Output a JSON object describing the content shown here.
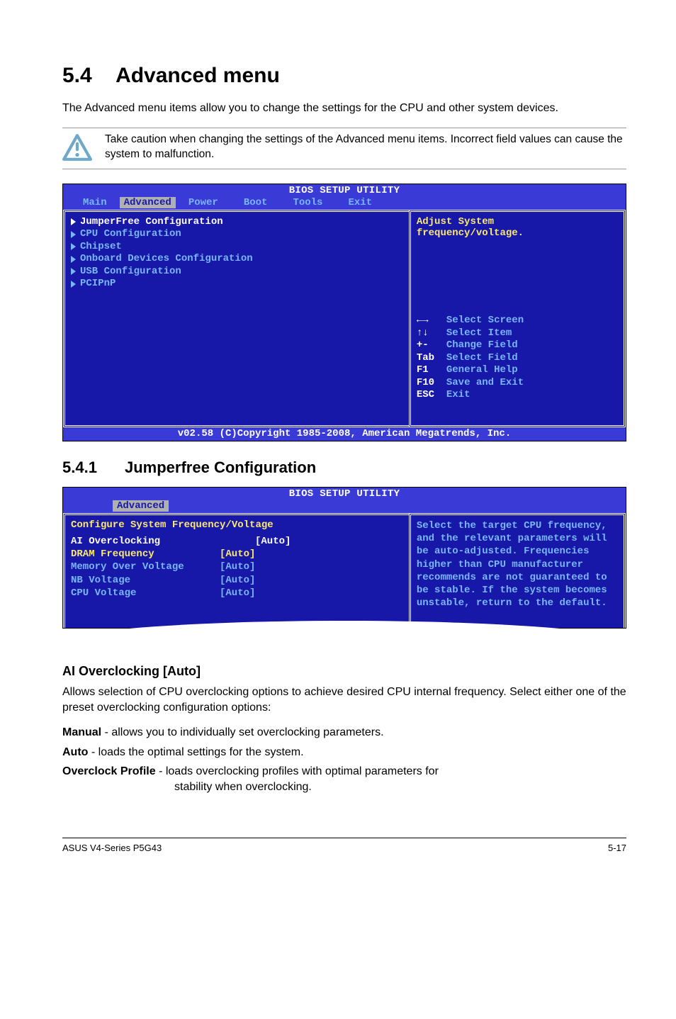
{
  "section": {
    "number": "5.4",
    "title": "Advanced menu",
    "intro": "The Advanced menu items allow you to change the settings for the CPU and other system devices.",
    "note": "Take caution when changing the settings of the Advanced menu items. Incorrect field values can cause the system to malfunction."
  },
  "bios1": {
    "title": "BIOS SETUP UTILITY",
    "tabs": [
      "Main",
      "Advanced",
      "Power",
      "Boot",
      "Tools",
      "Exit"
    ],
    "active_tab": "Advanced",
    "left_items": [
      "JumperFree Configuration",
      "CPU Configuration",
      "Chipset",
      "Onboard Devices Configuration",
      "USB Configuration",
      "PCIPnP"
    ],
    "highlight_index": 0,
    "right_help": "Adjust System\nfrequency/voltage.",
    "nav": [
      {
        "key": "←→",
        "label": "Select Screen"
      },
      {
        "key": "↑↓",
        "label": "Select Item"
      },
      {
        "key": "+-",
        "label": "Change Field"
      },
      {
        "key": "Tab",
        "label": "Select Field"
      },
      {
        "key": "F1",
        "label": "General Help"
      },
      {
        "key": "F10",
        "label": "Save and Exit"
      },
      {
        "key": "ESC",
        "label": "Exit"
      }
    ],
    "footer": "v02.58 (C)Copyright 1985-2008, American Megatrends, Inc."
  },
  "subsection": {
    "number": "5.4.1",
    "title": "Jumperfree Configuration"
  },
  "bios2": {
    "title": "BIOS SETUP UTILITY",
    "tab": "Advanced",
    "header": "Configure System Frequency/Voltage",
    "rows": [
      {
        "label": "AI Overclocking",
        "value": "[Auto]",
        "style": "white"
      },
      {
        "label": "DRAM Frequency",
        "value": "[Auto]",
        "style": "yellow"
      },
      {
        "label": "",
        "value": "",
        "style": "blue"
      },
      {
        "label": "Memory Over Voltage",
        "value": "[Auto]",
        "style": "blue"
      },
      {
        "label": "NB Voltage",
        "value": "[Auto]",
        "style": "blue"
      },
      {
        "label": "CPU Voltage",
        "value": "[Auto]",
        "style": "blue"
      }
    ],
    "help": "Select the target CPU frequency, and the relevant parameters will be auto-adjusted. Frequencies higher than CPU manufacturer recommends are not guaranteed to be stable. If the system becomes unstable, return to the default."
  },
  "ai_over": {
    "heading": "AI Overclocking [Auto]",
    "desc": "Allows selection of CPU overclocking options to achieve desired CPU internal frequency. Select either one of the preset overclocking configuration options:",
    "manual_label": "Manual",
    "manual_text": " - allows you to individually set overclocking parameters.",
    "auto_label": "Auto",
    "auto_text": " - loads the optimal settings for the system.",
    "prof_label": "Overclock Profile",
    "prof_text1": " - loads overclocking profiles with optimal parameters for",
    "prof_text2": "stability when overclocking."
  },
  "footer": {
    "left": "ASUS V4-Series P5G43",
    "right": "5-17"
  }
}
